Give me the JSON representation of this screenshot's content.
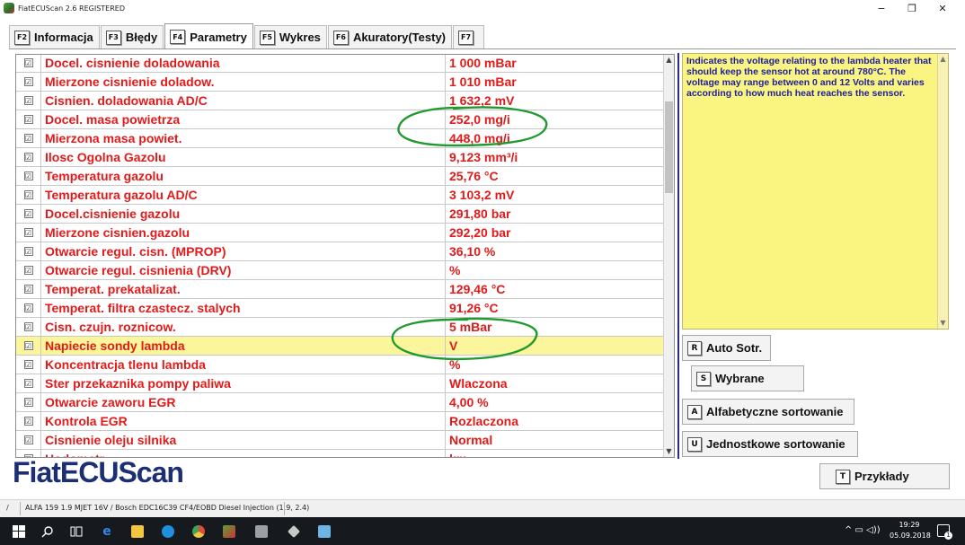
{
  "window": {
    "title": "FiatECUScan 2.6 REGISTERED",
    "minimize_glyph": "−",
    "maximize_glyph": "❐",
    "close_glyph": "✕"
  },
  "tabs": [
    {
      "key": "F2",
      "label": "Informacja"
    },
    {
      "key": "F3",
      "label": "Błędy"
    },
    {
      "key": "F4",
      "label": "Parametry",
      "active": true
    },
    {
      "key": "F5",
      "label": "Wykres"
    },
    {
      "key": "F6",
      "label": "Akuratory(Testy)"
    },
    {
      "key": "F7",
      "label": ""
    }
  ],
  "parameters": [
    {
      "checked": true,
      "name": "Docel. cisnienie doladowania",
      "value": "1 000 mBar"
    },
    {
      "checked": true,
      "name": "Mierzone cisnienie doladow.",
      "value": "1 010 mBar"
    },
    {
      "checked": true,
      "name": "Cisnien. doladowania AD/C",
      "value": "1 632,2 mV"
    },
    {
      "checked": true,
      "name": "Docel. masa powietrza",
      "value": "252,0 mg/i"
    },
    {
      "checked": true,
      "name": "Mierzona masa powiet.",
      "value": "448,0 mg/i"
    },
    {
      "checked": true,
      "name": "Ilosc Ogolna Gazolu",
      "value": "9,123 mm³/i"
    },
    {
      "checked": true,
      "name": "Temperatura gazolu",
      "value": "25,76 °C"
    },
    {
      "checked": true,
      "name": "Temperatura gazolu AD/C",
      "value": "3 103,2 mV"
    },
    {
      "checked": true,
      "name": "Docel.cisnienie gazolu",
      "value": "291,80 bar"
    },
    {
      "checked": true,
      "name": "Mierzone cisnien.gazolu",
      "value": "292,20 bar"
    },
    {
      "checked": true,
      "name": "Otwarcie regul. cisn. (MPROP)",
      "value": "36,10 %"
    },
    {
      "checked": true,
      "name": "Otwarcie regul. cisnienia (DRV)",
      "value": " %"
    },
    {
      "checked": true,
      "name": "Temperat. prekatalizat.",
      "value": "129,46 °C"
    },
    {
      "checked": true,
      "name": "Temperat. filtra czastecz. stalych",
      "value": "91,26 °C"
    },
    {
      "checked": true,
      "name": "Cisn. czujn. roznicow.",
      "value": "5 mBar"
    },
    {
      "checked": true,
      "name": "Napiecie sondy lambda",
      "value": "V",
      "selected": true
    },
    {
      "checked": true,
      "name": "Koncentracja tlenu lambda",
      "value": "%"
    },
    {
      "checked": true,
      "name": "Ster przekaznika pompy paliwa",
      "value": "Wlaczona"
    },
    {
      "checked": true,
      "name": "Otwarcie zaworu EGR",
      "value": "4,00 %"
    },
    {
      "checked": true,
      "name": "Kontrola EGR",
      "value": "Rozlaczona"
    },
    {
      "checked": true,
      "name": "Cisnienie oleju silnika",
      "value": "Normal"
    },
    {
      "checked": true,
      "name": "Hodometr",
      "value": "km"
    }
  ],
  "checkbox_glyph": "☑",
  "info_panel": {
    "text": "Indicates the voltage relating to the lambda heater that should keep the sensor hot at around 780°C. The voltage may range between 0 and 12 Volts and varies according to how much heat reaches the sensor."
  },
  "sort_buttons": [
    {
      "key": "R",
      "label": "Auto Sotr."
    },
    {
      "key": "S",
      "label": "Wybrane"
    },
    {
      "key": "A",
      "label": "Alfabetyczne sortowanie"
    },
    {
      "key": "U",
      "label": "Jednostkowe sortowanie"
    }
  ],
  "examples_button": {
    "key": "T",
    "label": "Przykłady"
  },
  "logo_text": "FiatECUScan",
  "status_bar": {
    "separator": "/",
    "text": "ALFA 159 1.9 MJET 16V / Bosch EDC16C39 CF4/EOBD Diesel Injection (1.9, 2.4)"
  },
  "taskbar": {
    "time": "19:29",
    "date": "05.09.2018",
    "tray_glyphs": "^ ▭ ◁))",
    "notification_count": "1",
    "apps": [
      "start-icon",
      "search-icon",
      "task-view-icon",
      "edge-icon",
      "file-explorer-icon",
      "skype-icon",
      "chrome-icon",
      "fiatecuscan-icon",
      "network-app-icon",
      "tools-icon",
      "paint-icon"
    ]
  },
  "colors": {
    "param_text": "#e21a1a",
    "selected_row": "#fbf69b",
    "info_bg": "#faf480",
    "info_text": "#1d1d9e",
    "logo": "#1c2f74",
    "annotation": "#1f9a2f"
  }
}
